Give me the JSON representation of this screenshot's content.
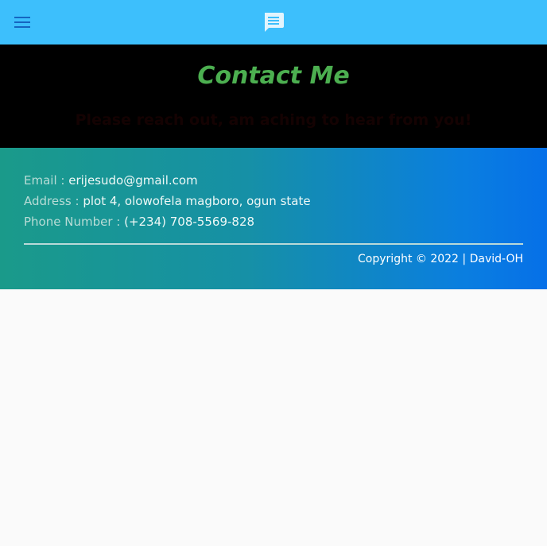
{
  "topbar": {
    "menu_icon": "hamburger-menu-icon",
    "center_icon": "chat-message-icon",
    "background": "#3dbffc"
  },
  "hero": {
    "title": "Contact Me",
    "subtitle": "Please reach out, am aching to hear from you!",
    "title_color": "#4caf50"
  },
  "contact": {
    "email_label": "Email : ",
    "email_value": "erijesudo@gmail.com",
    "address_label": "Address : ",
    "address_value": "plot 4, olowofela magboro, ogun state",
    "phone_label": "Phone Number : ",
    "phone_value": "(+234) 708-5569-828"
  },
  "footer": {
    "copyright": "Copyright © 2022 | David-OH"
  }
}
